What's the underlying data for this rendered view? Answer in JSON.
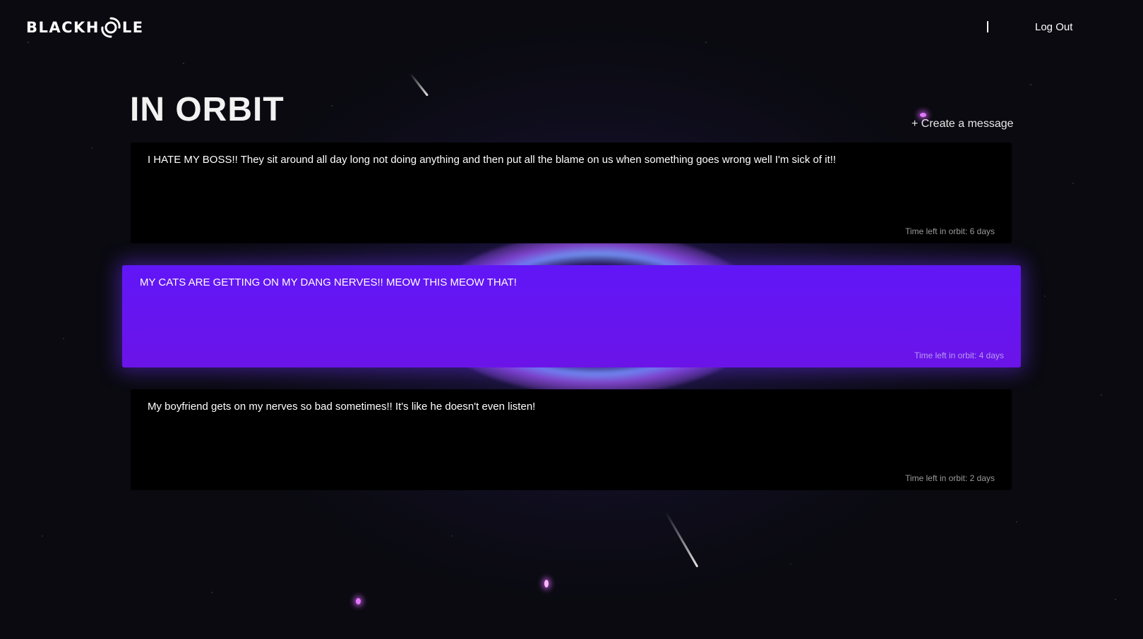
{
  "brand": {
    "logo_before": "BLACKH",
    "logo_after": "LE",
    "logo_mark_icon": "black-hole-swirl-icon"
  },
  "nav": {
    "logout_label": "Log Out"
  },
  "page": {
    "title": "IN ORBIT",
    "create_label": "+ Create a message"
  },
  "messages": [
    {
      "text": "I HATE MY BOSS!! They sit around all day long not doing anything and then put all the blame on us when something goes wrong well I'm sick of it!!",
      "time_left": "Time left in orbit: 6 days",
      "highlighted": false
    },
    {
      "text": "MY CATS ARE GETTING ON MY DANG NERVES!! MEOW THIS MEOW THAT!",
      "time_left": "Time left in orbit: 4 days",
      "highlighted": true
    },
    {
      "text": "My boyfriend gets on my nerves so bad sometimes!! It's like he doesn't even listen!",
      "time_left": "Time left in orbit: 2 days",
      "highlighted": false
    }
  ],
  "colors": {
    "background": "#0a0a10",
    "card": "#000000",
    "card_highlight": "#6116f7",
    "accent_glow": "#e377ff"
  }
}
